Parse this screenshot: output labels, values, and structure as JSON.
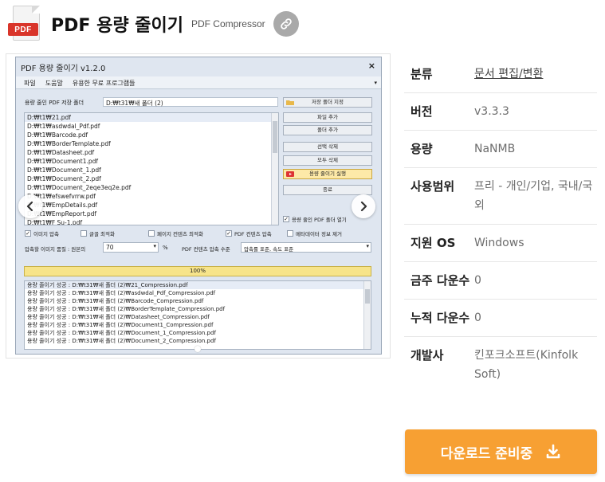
{
  "header": {
    "icon_label": "PDF",
    "title": "PDF 용량 줄이기",
    "subtitle": "PDF Compressor",
    "link_icon": "link-icon"
  },
  "screenshot": {
    "window_title": "PDF 용량 줄이기 v1.2.0",
    "close": "×",
    "menu": [
      "파일",
      "도움말",
      "유용한 무료 프로그램들"
    ],
    "output_label": "용량 줄인 PDF 저장 폴더",
    "output_path": "D:₩t31₩새 폴더 (2)",
    "buttons": [
      "저장 폴더 지정",
      "파일 추가",
      "폴더 추가",
      "선택 삭제",
      "모두 삭제",
      "용량 줄이기 실행",
      "종료"
    ],
    "files": [
      "D:₩t1₩21.pdf",
      "D:₩t1₩asdwdal_Pdf.pdf",
      "D:₩t1₩Barcode.pdf",
      "D:₩t1₩BorderTemplate.pdf",
      "D:₩t1₩Datasheet.pdf",
      "D:₩t1₩Document1.pdf",
      "D:₩t1₩Document_1.pdf",
      "D:₩t1₩Document_2.pdf",
      "D:₩t1₩Document_2eqe3eq2e.pdf",
      "D:₩t1₩efswefvrrw.pdf",
      "D:₩t1₩EmpDetails.pdf",
      "D:₩t1₩EmpReport.pdf",
      "D:₩t1₩F Su-1.pdf"
    ],
    "open_after": "용량 줄인 PDF 폴더 열기",
    "options": [
      "이미지 압축",
      "글꼴 최적화",
      "페이지 컨텐츠 최적화",
      "PDF 컨텐츠 압축",
      "메타데이터 정보 제거"
    ],
    "quality_label": "압축할 이미지 품질 : 원본의",
    "quality_value": "70",
    "percent": "%",
    "content_label": "PDF 컨텐츠 압축 수준",
    "content_value": "압축률 표준, 속도 표준",
    "progress": "100%",
    "log": [
      "용량 줄이기 성공 : D:₩t31₩새 폴더 (2)₩21_Compression.pdf",
      "용량 줄이기 성공 : D:₩t31₩새 폴더 (2)₩asdwdal_Pdf_Compression.pdf",
      "용량 줄이기 성공 : D:₩t31₩새 폴더 (2)₩Barcode_Compression.pdf",
      "용량 줄이기 성공 : D:₩t31₩새 폴더 (2)₩BorderTemplate_Compression.pdf",
      "용량 줄이기 성공 : D:₩t31₩새 폴더 (2)₩Datasheet_Compression.pdf",
      "용량 줄이기 성공 : D:₩t31₩새 폴더 (2)₩Document1_Compression.pdf",
      "용량 줄이기 성공 : D:₩t31₩새 폴더 (2)₩Document_1_Compression.pdf",
      "용량 줄이기 성공 : D:₩t31₩새 폴더 (2)₩Document_2_Compression.pdf"
    ]
  },
  "info": {
    "category_label": "분류",
    "category_value": "문서 편집/변환",
    "version_label": "버전",
    "version_value": "v3.3.3",
    "size_label": "용량",
    "size_value": "NaNMB",
    "license_label": "사용범위",
    "license_value": "프리 - 개인/기업, 국내/국외",
    "os_label": "지원 OS",
    "os_value": "Windows",
    "weekly_label": "금주 다운수",
    "weekly_value": "0",
    "total_label": "누적 다운수",
    "total_value": "0",
    "dev_label": "개발사",
    "dev_value": "킨포크소프트(Kinfolk Soft)"
  },
  "download": {
    "label": "다운로드 준비중",
    "icon": "download-icon"
  },
  "colors": {
    "download_bg": "#f7a033",
    "icon_red": "#d9352a",
    "link_circle": "#a9a9a9"
  }
}
